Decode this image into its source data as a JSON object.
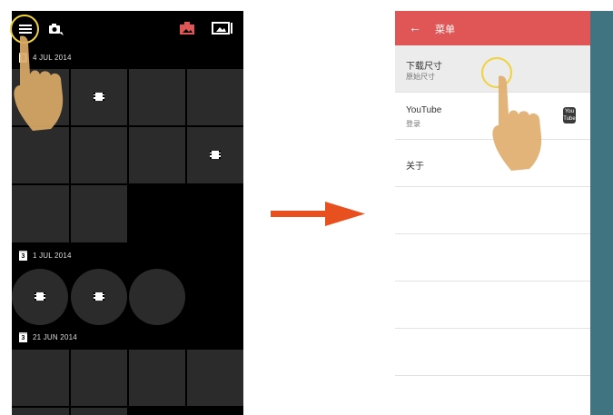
{
  "left_screen": {
    "toolbar": {
      "menu_icon": "hamburger-menu-icon",
      "camera_icon": "camera-switch-icon",
      "album_icon": "album-icon",
      "picture_icon": "picture-frame-icon"
    },
    "sections": [
      {
        "day": "3",
        "date": "4 JUL 2014"
      },
      {
        "day": "3",
        "date": "1 JUL 2014"
      },
      {
        "day": "3",
        "date": "21 JUN 2014"
      }
    ]
  },
  "right_screen": {
    "header": {
      "back_label": "←",
      "title": "菜单"
    },
    "items": [
      {
        "primary": "下载尺寸",
        "secondary": "原始尺寸"
      },
      {
        "primary": "YouTube",
        "secondary": "登录",
        "icon_text": "You Tube"
      },
      {
        "primary": "关于",
        "secondary": ""
      },
      {
        "primary": "",
        "secondary": ""
      },
      {
        "primary": "",
        "secondary": ""
      },
      {
        "primary": "",
        "secondary": ""
      },
      {
        "primary": "",
        "secondary": ""
      }
    ]
  },
  "colors": {
    "accent_red": "#e05656",
    "arrow": "#e8511f",
    "teal": "#3f7480",
    "highlight": "#f0d23a"
  }
}
